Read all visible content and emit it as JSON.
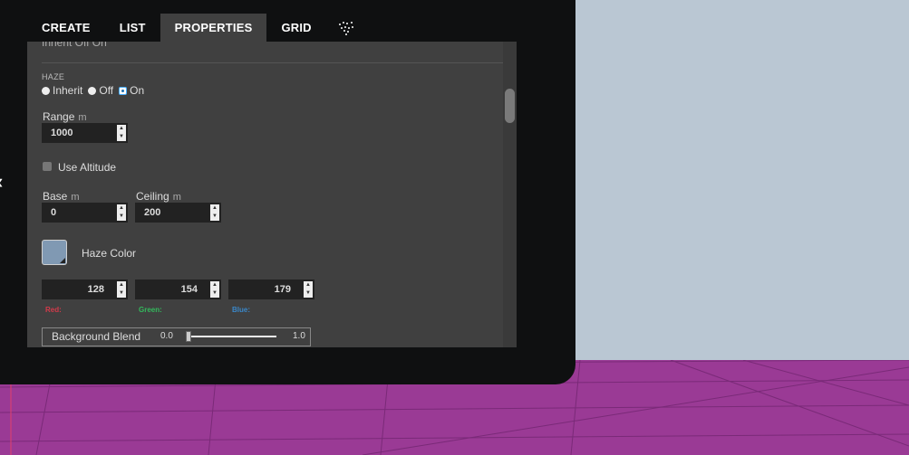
{
  "tabs": [
    {
      "label": "CREATE",
      "active": false
    },
    {
      "label": "LIST",
      "active": false
    },
    {
      "label": "PROPERTIES",
      "active": true
    },
    {
      "label": "GRID",
      "active": false
    }
  ],
  "tab_icon": "particles-icon",
  "clipped_row": "Inherit  Off  On",
  "haze": {
    "section_label": "HAZE",
    "radio_options": [
      "Inherit",
      "Off",
      "On"
    ],
    "selected": "On",
    "range": {
      "label": "Range",
      "unit": "m",
      "value": "1000"
    },
    "use_altitude": {
      "label": "Use Altitude",
      "checked": false
    },
    "base": {
      "label": "Base",
      "unit": "m",
      "value": "0"
    },
    "ceiling": {
      "label": "Ceiling",
      "unit": "m",
      "value": "200"
    },
    "color": {
      "label": "Haze Color",
      "swatch": "#8099b3",
      "red": {
        "label": "Red:",
        "value": "128",
        "color": "#d23a4a"
      },
      "green": {
        "label": "Green:",
        "value": "154",
        "color": "#33b85c"
      },
      "blue": {
        "label": "Blue:",
        "value": "179",
        "color": "#3a87c8"
      }
    },
    "background_blend": {
      "label": "Background Blend",
      "min_label": "0.0",
      "max_label": "1.0",
      "value": 0.0
    }
  },
  "colors": {
    "panel_bg": "#404040",
    "frame": "#0f1011",
    "sky": "#bac7d3",
    "ground": "#9a3a95"
  }
}
